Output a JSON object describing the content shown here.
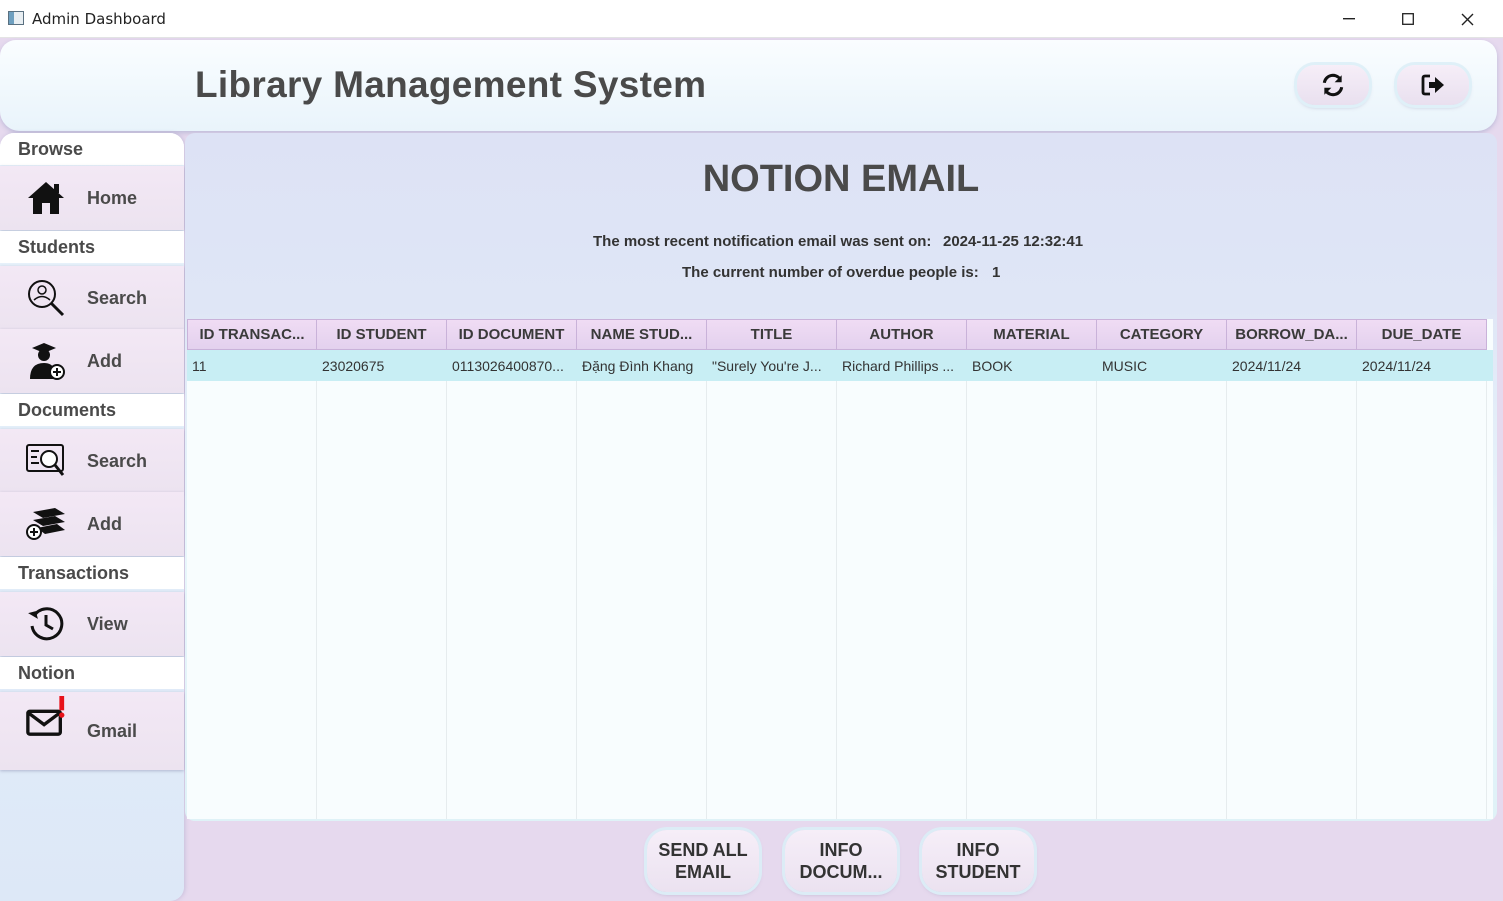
{
  "window": {
    "title": "Admin Dashboard",
    "minimize": "—",
    "maximize": "☐",
    "close": "✕"
  },
  "header": {
    "title": "Library Management System",
    "refresh_icon": "refresh-icon",
    "logout_icon": "logout-icon"
  },
  "sidebar": {
    "sections": {
      "browse": "Browse",
      "students": "Students",
      "documents": "Documents",
      "transactions": "Transactions",
      "notion": "Notion"
    },
    "items": {
      "home": "Home",
      "student_search": "Search",
      "student_add": "Add",
      "document_search": "Search",
      "document_add": "Add",
      "transactions_view": "View",
      "gmail": "Gmail"
    }
  },
  "main": {
    "title": "NOTION EMAIL",
    "recent_label": "The most recent notification email was sent on:",
    "recent_value": "2024-11-25 12:32:41",
    "overdue_label": "The current number of overdue people is:",
    "overdue_value": "1",
    "table": {
      "columns": [
        "ID TRANSAC...",
        "ID STUDENT",
        "ID DOCUMENT",
        "NAME STUD...",
        "TITLE",
        "AUTHOR",
        "MATERIAL",
        "CATEGORY",
        "BORROW_DA...",
        "DUE_DATE"
      ],
      "rows": [
        [
          "11",
          "23020675",
          "0113026400870...",
          "Đặng Đình Khang",
          "\"Surely You're J...",
          "Richard Phillips ...",
          "BOOK",
          "MUSIC",
          "2024/11/24",
          "2024/11/24"
        ]
      ]
    }
  },
  "buttons": {
    "send_all_line1": "SEND ALL",
    "send_all_line2": "EMAIL",
    "info_doc_line1": "INFO",
    "info_doc_line2": "DOCUM...",
    "info_student_line1": "INFO",
    "info_student_line2": "STUDENT"
  }
}
